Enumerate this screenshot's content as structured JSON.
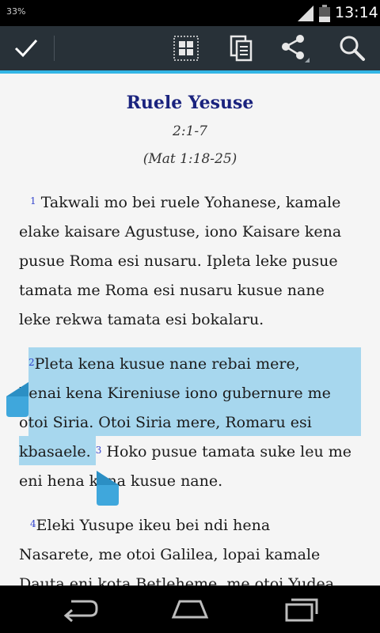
{
  "status_bar": {
    "battery_percent": "33%",
    "time": "13:14"
  },
  "action_bar": {
    "icons": [
      "checkmark-icon",
      "grid-icon",
      "copy-icon",
      "share-icon",
      "search-icon"
    ]
  },
  "reader": {
    "heading": "Ruele Yesuse",
    "reference": "2:1-7",
    "parallel_reference": "(Mat 1:18-25)",
    "verses": [
      {
        "num": "1",
        "lines": [
          "Takwali mo bei ruele Yohanese, kamale",
          "elake kaisare Agustuse, iono Kaisare kena",
          "pusue Roma esi nusaru. Ipleta leke pusue",
          "tamata me Roma esi nusaru kusue nane",
          "leke rekwa tamata esi bokalaru."
        ]
      },
      {
        "num": "2",
        "lines": [
          "Pleta kena kusue nane rebai mere,",
          "henai kena Kireniuse iono gubernure me",
          "otoi Siria. Otoi Siria mere, Romaru esi",
          "kbasaele."
        ]
      },
      {
        "num": "3",
        "text_after": "Hoko pusue tamata suke leu me",
        "line2": "eni hena kena kusue nane."
      },
      {
        "num": "4",
        "lines": [
          "Eleki Yusupe ikeu bei ndi hena",
          "Nasarete, me otoi Galilea, lopai kamale",
          "Dauta eni kota Betleheme, me otoi Yudea"
        ]
      }
    ]
  },
  "colors": {
    "action_bar": "#283138",
    "accent": "#33b5e5",
    "selection": "#a7d7ee",
    "heading": "#1a237e"
  }
}
